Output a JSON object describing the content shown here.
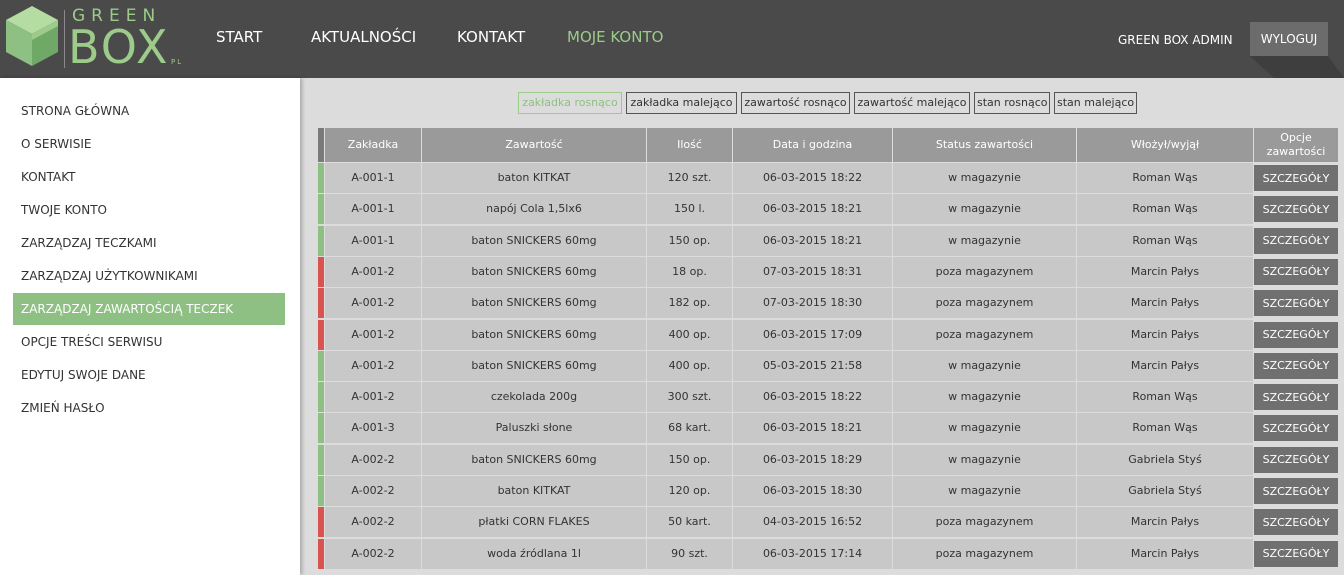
{
  "header": {
    "logo_top": "GREEN",
    "logo_main": "BOX",
    "logo_suffix": "PL",
    "nav": [
      "START",
      "AKTUALNOŚCI",
      "KONTAKT",
      "MOJE KONTO"
    ],
    "active_nav": "MOJE KONTO",
    "admin_name": "GREEN BOX ADMIN",
    "logout_label": "WYLOGUJ"
  },
  "sidebar": {
    "items": [
      "STRONA GŁÓWNA",
      "O SERWISIE",
      "KONTAKT",
      "TWOJE KONTO",
      "ZARZĄDZAJ TECZKAMI",
      "ZARZĄDZAJ UŻYTKOWNIKAMI",
      "ZARZĄDZAJ ZAWARTOŚCIĄ TECZEK",
      "OPCJE TREŚCI SERWISU",
      "EDYTUJ SWOJE DANE",
      "ZMIEŃ HASŁO"
    ],
    "active_item": "ZARZĄDZAJ ZAWARTOŚCIĄ TECZEK"
  },
  "sort_options": [
    "zakładka rosnąco",
    "zakładka malejąco",
    "zawartość rosnąco",
    "zawartość malejąco",
    "stan rosnąco",
    "stan malejąco"
  ],
  "active_sort": "zakładka rosnąco",
  "table": {
    "columns": [
      "Zakładka",
      "Zawartość",
      "Ilość",
      "Data i godzina",
      "Status zawartości",
      "Włożył/wyjął",
      "Opcje zawartości"
    ],
    "details_label": "SZCZEGÓŁY",
    "rows": [
      {
        "tab": "A-001-1",
        "content": "baton KITKAT",
        "qty": "120 szt.",
        "date": "06-03-2015 18:22",
        "status": "w magazynie",
        "person": "Roman Wąs",
        "state": "in"
      },
      {
        "tab": "A-001-1",
        "content": "napój Cola 1,5lx6",
        "qty": "150 l.",
        "date": "06-03-2015 18:21",
        "status": "w magazynie",
        "person": "Roman Wąs",
        "state": "in"
      },
      {
        "tab": "A-001-1",
        "content": "baton SNICKERS 60mg",
        "qty": "150 op.",
        "date": "06-03-2015 18:21",
        "status": "w magazynie",
        "person": "Roman Wąs",
        "state": "in"
      },
      {
        "tab": "A-001-2",
        "content": "baton SNICKERS 60mg",
        "qty": "18 op.",
        "date": "07-03-2015 18:31",
        "status": "poza magazynem",
        "person": "Marcin Pałys",
        "state": "out"
      },
      {
        "tab": "A-001-2",
        "content": "baton SNICKERS 60mg",
        "qty": "182 op.",
        "date": "07-03-2015 18:30",
        "status": "poza magazynem",
        "person": "Marcin Pałys",
        "state": "out"
      },
      {
        "tab": "A-001-2",
        "content": "baton SNICKERS 60mg",
        "qty": "400 op.",
        "date": "06-03-2015 17:09",
        "status": "poza magazynem",
        "person": "Marcin Pałys",
        "state": "out"
      },
      {
        "tab": "A-001-2",
        "content": "baton SNICKERS 60mg",
        "qty": "400 op.",
        "date": "05-03-2015 21:58",
        "status": "w magazynie",
        "person": "Marcin Pałys",
        "state": "in"
      },
      {
        "tab": "A-001-2",
        "content": "czekolada 200g",
        "qty": "300 szt.",
        "date": "06-03-2015 18:22",
        "status": "w magazynie",
        "person": "Roman Wąs",
        "state": "in"
      },
      {
        "tab": "A-001-3",
        "content": "Paluszki słone",
        "qty": "68 kart.",
        "date": "06-03-2015 18:21",
        "status": "w magazynie",
        "person": "Roman Wąs",
        "state": "in"
      },
      {
        "tab": "A-002-2",
        "content": "baton SNICKERS 60mg",
        "qty": "150 op.",
        "date": "06-03-2015 18:29",
        "status": "w magazynie",
        "person": "Gabriela Styś",
        "state": "in"
      },
      {
        "tab": "A-002-2",
        "content": "baton KITKAT",
        "qty": "120 op.",
        "date": "06-03-2015 18:30",
        "status": "w magazynie",
        "person": "Gabriela Styś",
        "state": "in"
      },
      {
        "tab": "A-002-2",
        "content": "płatki CORN FLAKES",
        "qty": "50 kart.",
        "date": "04-03-2015 16:52",
        "status": "poza magazynem",
        "person": "Marcin Pałys",
        "state": "out"
      },
      {
        "tab": "A-002-2",
        "content": "woda źródlana 1l",
        "qty": "90 szt.",
        "date": "06-03-2015 17:14",
        "status": "poza magazynem",
        "person": "Marcin Pałys",
        "state": "out"
      }
    ]
  },
  "colors": {
    "accent": "#8ec084",
    "header_bg": "#4a4a4a",
    "in_stock": "#8ec084",
    "out_of_stock": "#d9534f"
  }
}
